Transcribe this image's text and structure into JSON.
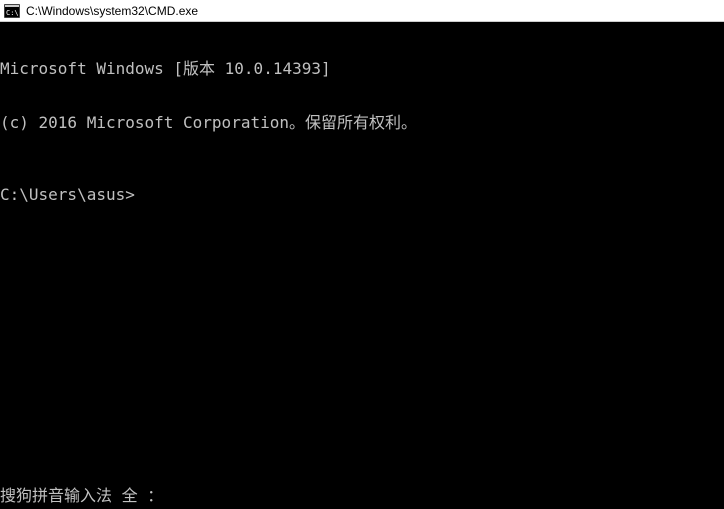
{
  "titlebar": {
    "title": "C:\\Windows\\system32\\CMD.exe",
    "icon": "cmd-icon"
  },
  "terminal": {
    "line1": "Microsoft Windows [版本 10.0.14393]",
    "line2": "(c) 2016 Microsoft Corporation。保留所有权利。",
    "prompt": "C:\\Users\\asus>"
  },
  "ime": {
    "status": "搜狗拼音输入法 全 ："
  }
}
